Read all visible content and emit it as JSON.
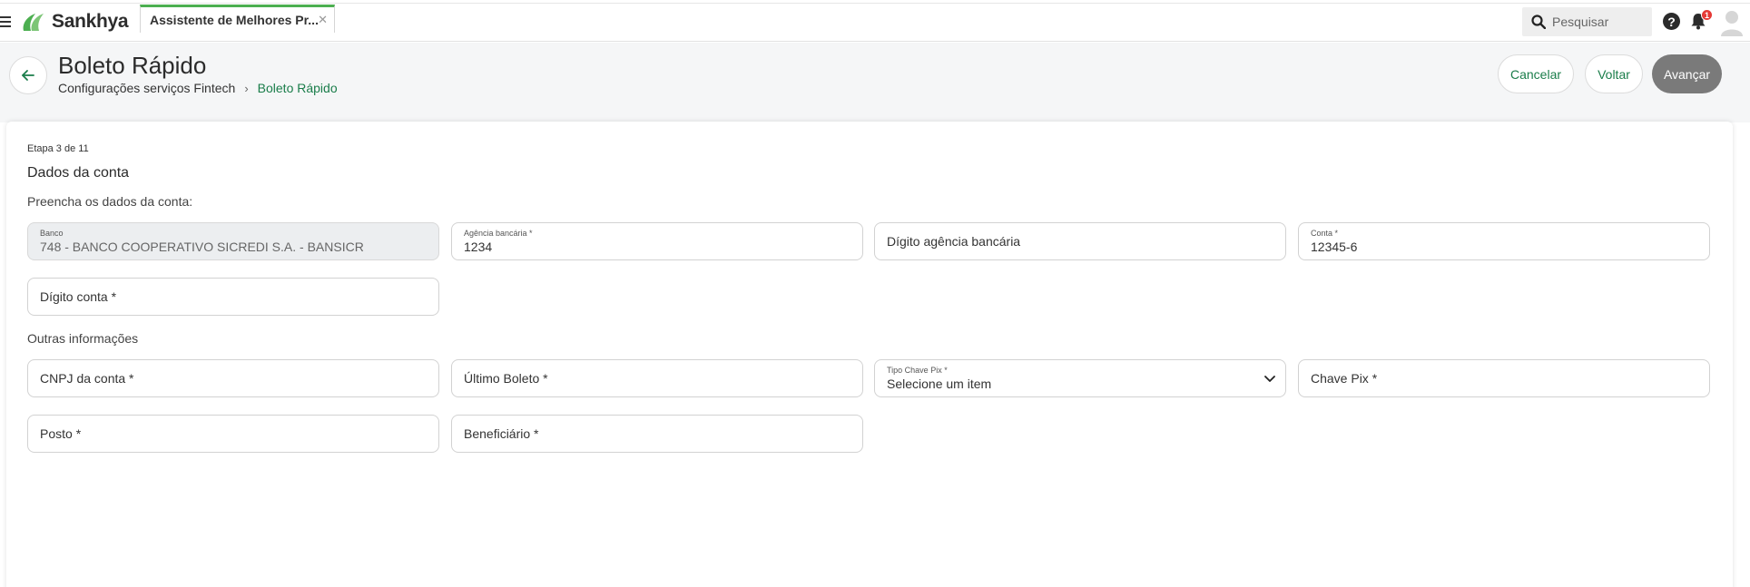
{
  "topbar": {
    "brand": "Sankhya",
    "open_tab": "Assistente de Melhores Pr...",
    "search_placeholder": "Pesquisar",
    "help_glyph": "?",
    "notification_count": "1",
    "brand_color": "#4caf50"
  },
  "header": {
    "title": "Boleto Rápido",
    "breadcrumb_parent": "Configurações serviços Fintech",
    "breadcrumb_sep": "›",
    "breadcrumb_current": "Boleto Rápido",
    "cancel_label": "Cancelar",
    "back_label": "Voltar",
    "next_label": "Avançar",
    "accent_color": "#1a7d4a"
  },
  "form": {
    "step": "Etapa 3 de 11",
    "title": "Dados da conta",
    "subtitle": "Preencha os dados da conta:",
    "other_section": "Outras informações",
    "banco": {
      "label": "Banco",
      "value": "748 - BANCO COOPERATIVO SICREDI S.A. - BANSICR"
    },
    "agencia": {
      "label": "Agência bancária *",
      "value": "1234"
    },
    "digito_agencia": {
      "placeholder": "Dígito agência bancária"
    },
    "conta": {
      "label": "Conta *",
      "value": "12345-6"
    },
    "digito_conta": {
      "placeholder": "Dígito conta *"
    },
    "cnpj": {
      "placeholder": "CNPJ da conta *"
    },
    "ultimo_boleto": {
      "placeholder": "Último Boleto *"
    },
    "tipo_chave_pix": {
      "label": "Tipo Chave Pix *",
      "value": "Selecione um item"
    },
    "chave_pix": {
      "placeholder": "Chave Pix *"
    },
    "posto": {
      "placeholder": "Posto *"
    },
    "beneficiario": {
      "placeholder": "Beneficiário *"
    }
  }
}
